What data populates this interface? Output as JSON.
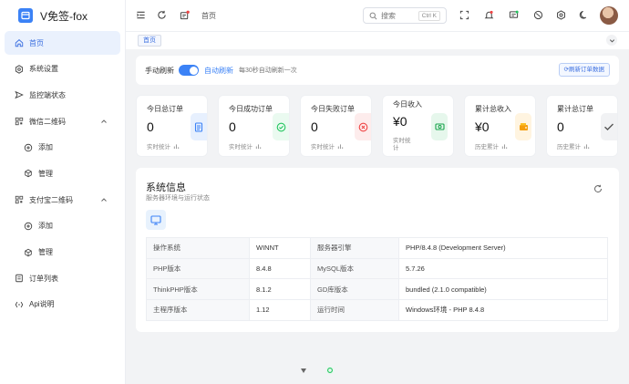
{
  "app": {
    "title": "V免签-fox"
  },
  "sidebar": {
    "items": [
      {
        "label": "首页",
        "icon": "home-icon"
      },
      {
        "label": "系统设置",
        "icon": "settings-icon"
      },
      {
        "label": "监控端状态",
        "icon": "send-icon"
      },
      {
        "label": "微信二维码",
        "icon": "qrcode-icon"
      },
      {
        "label": "添加",
        "icon": "plus-circle-icon"
      },
      {
        "label": "管理",
        "icon": "cube-icon"
      },
      {
        "label": "支付宝二维码",
        "icon": "qrcode-icon"
      },
      {
        "label": "添加",
        "icon": "plus-circle-icon"
      },
      {
        "label": "管理",
        "icon": "cube-icon"
      },
      {
        "label": "订单列表",
        "icon": "list-icon"
      },
      {
        "label": "Api说明",
        "icon": "code-icon"
      }
    ]
  },
  "header": {
    "breadcrumb": "首页",
    "search": {
      "placeholder": "搜索",
      "shortcut": "Ctrl K"
    }
  },
  "tabs": [
    {
      "label": "首页"
    }
  ],
  "refresh": {
    "manual_label": "手动刷新",
    "auto_label": "自动刷新",
    "interval_text": "每30秒自动刷新一次",
    "button_label": "刷新订单数据",
    "auto_enabled": true
  },
  "stats": [
    {
      "title": "今日总订单",
      "value": "0",
      "foot": "实时统计",
      "icon": "document-icon",
      "color": "#3b82f6",
      "bg": "#e7f0fe"
    },
    {
      "title": "今日成功订单",
      "value": "0",
      "foot": "实时统计",
      "icon": "check-circle-icon",
      "color": "#22c55e",
      "bg": "#eafaf0"
    },
    {
      "title": "今日失败订单",
      "value": "0",
      "foot": "实时统计",
      "icon": "x-circle-icon",
      "color": "#ef4444",
      "bg": "#fdecec"
    },
    {
      "title": "今日收入",
      "value": "¥0",
      "foot": "实时统计",
      "icon": "money-icon",
      "color": "#16a34a",
      "bg": "#e6f7ec"
    },
    {
      "title": "累计总收入",
      "value": "¥0",
      "foot": "历史累计",
      "icon": "wallet-icon",
      "color": "#f59e0b",
      "bg": "#fff4e0"
    },
    {
      "title": "累计总订单",
      "value": "0",
      "foot": "历史累计",
      "icon": "check-icon",
      "color": "#555555",
      "bg": "#f1f2f4"
    }
  ],
  "system": {
    "title": "系统信息",
    "subtitle": "服务器环境与运行状态",
    "rows": [
      {
        "k1": "操作系统",
        "v1": "WINNT",
        "k2": "服务器引擎",
        "v2": "PHP/8.4.8 (Development Server)"
      },
      {
        "k1": "PHP版本",
        "v1": "8.4.8",
        "k2": "MySQL版本",
        "v2": "5.7.26"
      },
      {
        "k1": "ThinkPHP版本",
        "v1": "8.1.2",
        "k2": "GD库版本",
        "v2": "bundled (2.1.0 compatible)"
      },
      {
        "k1": "主程序版本",
        "v1": "1.12",
        "k2": "运行时间",
        "v2": "Windows环境 - PHP 8.4.8"
      }
    ]
  },
  "colors": {
    "accent": "#3b82f6"
  }
}
